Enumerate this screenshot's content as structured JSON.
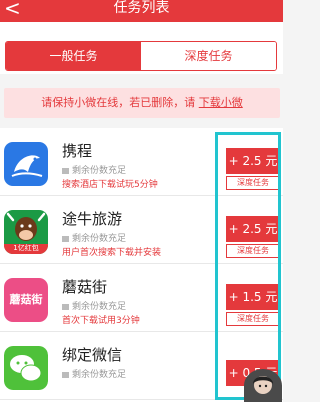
{
  "header": {
    "back_glyph": "<",
    "title": "任务列表"
  },
  "tabs": [
    {
      "label": "一般任务",
      "active": true
    },
    {
      "label": "深度任务",
      "active": false
    }
  ],
  "notice": {
    "text": "请保持小微在线，若已删除，请 ",
    "link": "下载小微"
  },
  "tasks": [
    {
      "name": "携程",
      "remaining": "剩余份数充足",
      "desc": "搜索酒店下载试玩5分钟",
      "reward": "+ 2.5 元",
      "tag": "深度任务",
      "icon": "ctrip-dolphin-icon"
    },
    {
      "name": "途牛旅游",
      "remaining": "剩余份数充足",
      "desc": "用户首次搜索下载并安装",
      "reward": "+ 2.5 元",
      "tag": "深度任务",
      "icon": "tuniu-cow-icon",
      "icon_badge": "1亿红包"
    },
    {
      "name": "蘑菇街",
      "remaining": "剩余份数充足",
      "desc": "首次下载试用3分钟",
      "reward": "+ 1.5 元",
      "tag": "深度任务",
      "icon": "mogujie-icon",
      "icon_text": "蘑菇街"
    },
    {
      "name": "绑定微信",
      "remaining": "剩余份数充足",
      "desc": "",
      "reward": "+ 0.5 元",
      "tag": "",
      "icon": "wechat-icon"
    }
  ],
  "colors": {
    "accent": "#e4393c",
    "highlight": "#21c4cf"
  }
}
